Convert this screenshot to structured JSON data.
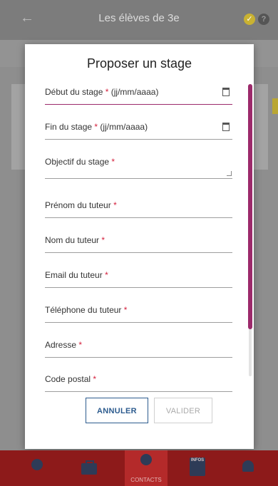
{
  "header": {
    "back_icon": "arrow-left-icon",
    "title": "Les élèves de 3e",
    "status_icon": "check-circle-icon",
    "help_label": "?"
  },
  "modal": {
    "title": "Proposer un stage",
    "fields": [
      {
        "label": "Début du stage",
        "hint": "(jj/mm/aaaa)",
        "required": "*",
        "type": "date",
        "active": true
      },
      {
        "label": "Fin du stage",
        "hint": "(jj/mm/aaaa)",
        "required": "*",
        "type": "date",
        "active": false
      },
      {
        "label": "Objectif du stage",
        "hint": "",
        "required": "*",
        "type": "textarea",
        "active": false
      },
      {
        "label": "Prénom du tuteur",
        "hint": "",
        "required": "*",
        "type": "text",
        "active": false
      },
      {
        "label": "Nom du tuteur",
        "hint": "",
        "required": "*",
        "type": "text",
        "active": false
      },
      {
        "label": "Email du tuteur",
        "hint": "",
        "required": "*",
        "type": "text",
        "active": false
      },
      {
        "label": "Téléphone du tuteur",
        "hint": "",
        "required": "*",
        "type": "text",
        "active": false
      },
      {
        "label": "Adresse",
        "hint": "",
        "required": "*",
        "type": "text",
        "active": false
      },
      {
        "label": "Code postal",
        "hint": "",
        "required": "*",
        "type": "text",
        "active": false
      }
    ],
    "cancel_label": "ANNULER",
    "validate_label": "VALIDER"
  },
  "bottom_nav": {
    "items": [
      {
        "icon": "user-icon",
        "label": ""
      },
      {
        "icon": "briefcase-icon",
        "label": ""
      },
      {
        "icon": "chat-icon",
        "label": "CONTACTS"
      },
      {
        "icon": "info-list-icon",
        "label": "INFOS"
      },
      {
        "icon": "bell-icon",
        "label": ""
      }
    ]
  },
  "colors": {
    "accent": "#9c2a6b",
    "required": "#d4213d",
    "nav_background": "#8d1a1a",
    "primary_button": "#2c5b8e"
  }
}
